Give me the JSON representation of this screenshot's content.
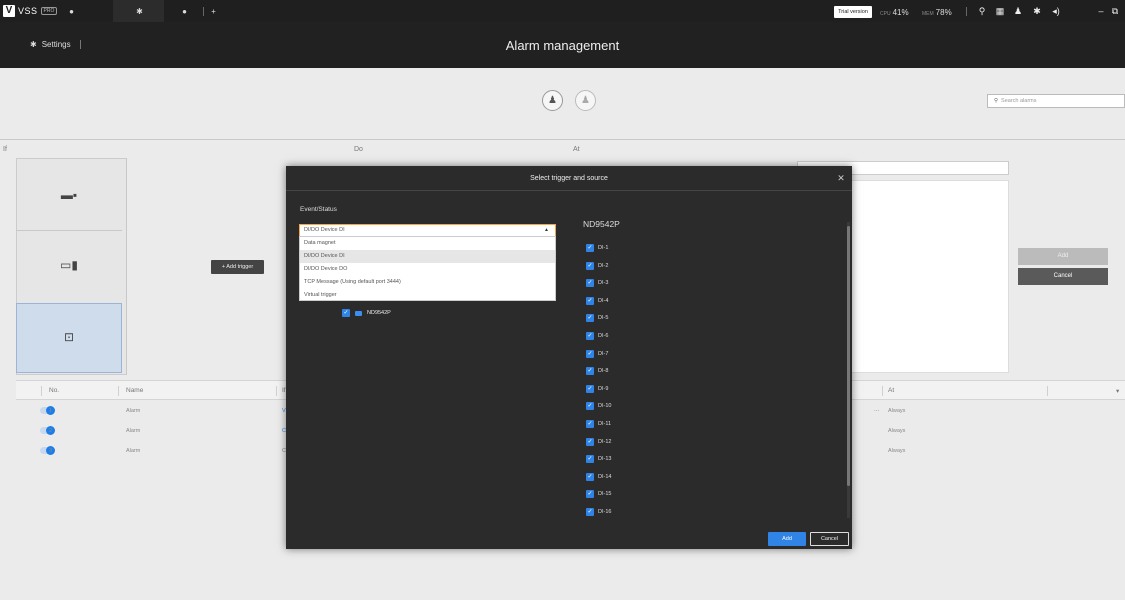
{
  "topbar": {
    "brand": "VSS",
    "brand_badge": "PRO",
    "add_tab_icon": "plus-icon",
    "trial_label": "Trial version",
    "cpu_label": "CPU",
    "cpu_value": "41%",
    "mem_label": "MEM",
    "mem_value": "78%",
    "icons": [
      "search-icon",
      "grid-icon",
      "bell-icon",
      "gear-icon",
      "speaker-icon",
      "minimize-icon",
      "restore-icon"
    ]
  },
  "header": {
    "settings_label": "Settings",
    "title": "Alarm management"
  },
  "toolbar": {
    "search_placeholder": "Search alarms"
  },
  "columns": {
    "if": "If",
    "do": "Do",
    "at": "At"
  },
  "editor": {
    "add_trigger": "+ Add trigger",
    "add": "Add",
    "cancel": "Cancel"
  },
  "table": {
    "headers": {
      "no": "No.",
      "name": "Name",
      "if": "If",
      "at": "At"
    },
    "rows": [
      {
        "no": "1",
        "name": "Alarm",
        "if_text": "V",
        "at": "Always",
        "more": "···"
      },
      {
        "no": "2",
        "name": "Alarm",
        "if_text": "C",
        "at": "Always",
        "more": ""
      },
      {
        "no": "3",
        "name": "Alarm",
        "if_text": "C",
        "at": "Always",
        "more": ""
      }
    ]
  },
  "modal": {
    "title": "Select trigger and source",
    "event_label": "Event/Status",
    "selected_event": "DI/DO Device DI",
    "options": [
      "Data magnet",
      "DI/DO Device DI",
      "DI/DO Device DO",
      "TCP Message (Using default port 3444)",
      "Virtual trigger"
    ],
    "device_name": "ND9542P",
    "source_title": "ND9542P",
    "inputs": [
      "DI-1",
      "DI-2",
      "DI-3",
      "DI-4",
      "DI-5",
      "DI-6",
      "DI-7",
      "DI-8",
      "DI-9",
      "DI-10",
      "DI-11",
      "DI-12",
      "DI-13",
      "DI-14",
      "DI-15",
      "DI-16"
    ],
    "add": "Add",
    "cancel": "Cancel"
  }
}
